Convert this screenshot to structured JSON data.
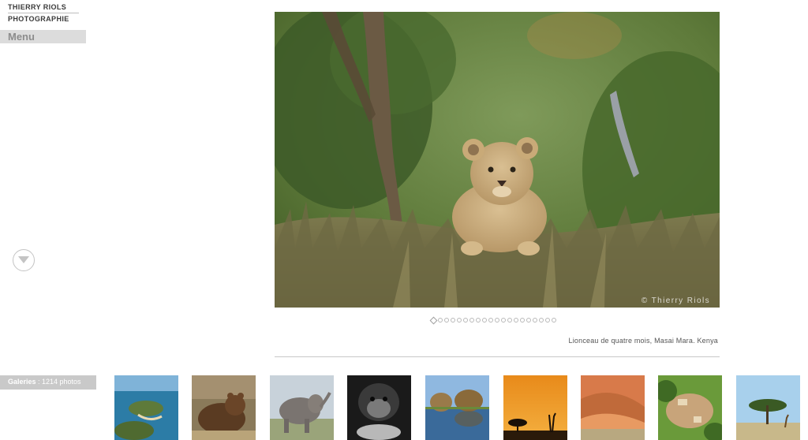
{
  "logo": {
    "line1": "THIERRY RIOLS",
    "line2": "PHOTOGRAPHIE"
  },
  "menu": {
    "label": "Menu"
  },
  "main_photo": {
    "watermark": "© Thierry Riols",
    "caption": "Lionceau de quatre mois, Masai Mara. Kenya"
  },
  "slideshow": {
    "total": 20,
    "current": 1
  },
  "galleries": {
    "label": "Galeries",
    "separator": " : ",
    "count": "1214 photos"
  },
  "thumbnails": [
    {
      "name": "island-coast-thumbnail"
    },
    {
      "name": "brown-bear-thumbnail"
    },
    {
      "name": "elephant-thumbnail"
    },
    {
      "name": "gorilla-thumbnail"
    },
    {
      "name": "lake-reflection-thumbnail"
    },
    {
      "name": "giraffe-sunset-thumbnail"
    },
    {
      "name": "desert-dunes-thumbnail"
    },
    {
      "name": "village-aerial-thumbnail"
    },
    {
      "name": "acacia-giraffe-thumbnail"
    }
  ]
}
